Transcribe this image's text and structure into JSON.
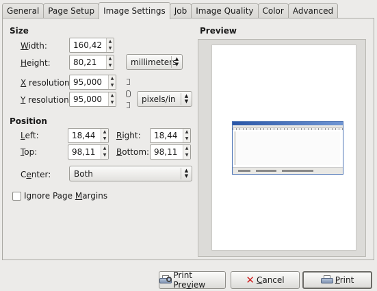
{
  "tabs": [
    {
      "label": "General",
      "active": false
    },
    {
      "label": "Page Setup",
      "active": false
    },
    {
      "label": "Image Settings",
      "active": true
    },
    {
      "label": "Job",
      "active": false
    },
    {
      "label": "Image Quality",
      "active": false
    },
    {
      "label": "Color",
      "active": false
    },
    {
      "label": "Advanced",
      "active": false
    }
  ],
  "size": {
    "title": "Size",
    "width_label_u": "W",
    "width_label_rest": "idth:",
    "width_value": "160,42",
    "height_label_u": "H",
    "height_label_rest": "eight:",
    "height_value": "80,21",
    "unit": "millimeters",
    "xres_label_u": "X",
    "xres_label_rest": " resolution:",
    "xres_value": "95,000",
    "yres_label_u": "Y",
    "yres_label_rest": " resolution:",
    "yres_value": "95,000",
    "res_unit": "pixels/in"
  },
  "position": {
    "title": "Position",
    "left_label_u": "L",
    "left_label_rest": "eft:",
    "left_value": "18,44",
    "right_label_u": "R",
    "right_label_rest": "ight:",
    "right_value": "18,44",
    "top_label_u": "T",
    "top_label_rest": "op:",
    "top_value": "98,11",
    "bottom_label_u": "B",
    "bottom_label_rest": "ottom:",
    "bottom_value": "98,11",
    "center_label_pre": "C",
    "center_label_u": "e",
    "center_label_rest": "nter:",
    "center_value": "Both"
  },
  "ignore_margins": {
    "label_pre": "Ignore Page ",
    "label_u": "M",
    "label_rest": "argins",
    "checked": false
  },
  "preview": {
    "title": "Preview"
  },
  "buttons": {
    "print_preview_pre": "Print Pre",
    "print_preview_u": "v",
    "print_preview_rest": "iew",
    "cancel_u": "C",
    "cancel_rest": "ancel",
    "print_u": "P",
    "print_rest": "rint"
  }
}
